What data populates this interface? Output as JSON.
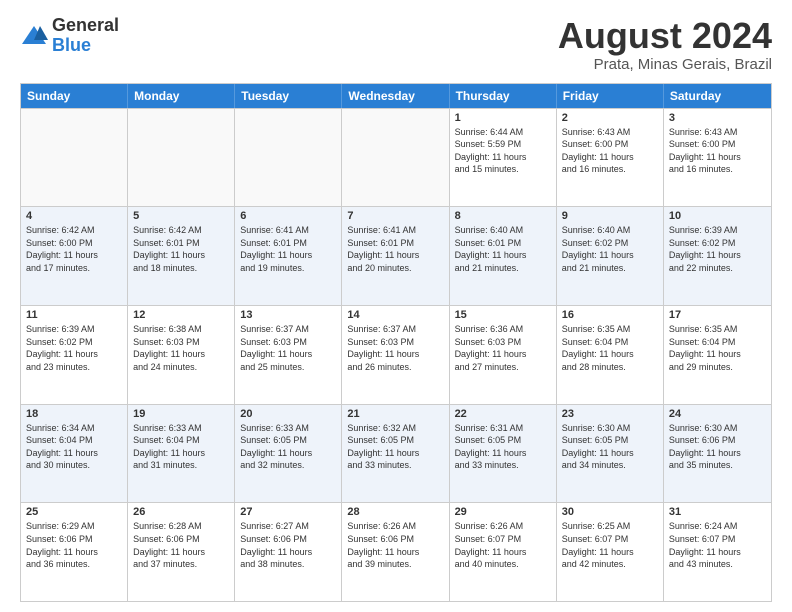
{
  "header": {
    "logo_general": "General",
    "logo_blue": "Blue",
    "month_title": "August 2024",
    "location": "Prata, Minas Gerais, Brazil"
  },
  "calendar": {
    "days_of_week": [
      "Sunday",
      "Monday",
      "Tuesday",
      "Wednesday",
      "Thursday",
      "Friday",
      "Saturday"
    ],
    "rows": [
      [
        {
          "day": "",
          "info": ""
        },
        {
          "day": "",
          "info": ""
        },
        {
          "day": "",
          "info": ""
        },
        {
          "day": "",
          "info": ""
        },
        {
          "day": "1",
          "info": "Sunrise: 6:44 AM\nSunset: 5:59 PM\nDaylight: 11 hours\nand 15 minutes."
        },
        {
          "day": "2",
          "info": "Sunrise: 6:43 AM\nSunset: 6:00 PM\nDaylight: 11 hours\nand 16 minutes."
        },
        {
          "day": "3",
          "info": "Sunrise: 6:43 AM\nSunset: 6:00 PM\nDaylight: 11 hours\nand 16 minutes."
        }
      ],
      [
        {
          "day": "4",
          "info": "Sunrise: 6:42 AM\nSunset: 6:00 PM\nDaylight: 11 hours\nand 17 minutes."
        },
        {
          "day": "5",
          "info": "Sunrise: 6:42 AM\nSunset: 6:01 PM\nDaylight: 11 hours\nand 18 minutes."
        },
        {
          "day": "6",
          "info": "Sunrise: 6:41 AM\nSunset: 6:01 PM\nDaylight: 11 hours\nand 19 minutes."
        },
        {
          "day": "7",
          "info": "Sunrise: 6:41 AM\nSunset: 6:01 PM\nDaylight: 11 hours\nand 20 minutes."
        },
        {
          "day": "8",
          "info": "Sunrise: 6:40 AM\nSunset: 6:01 PM\nDaylight: 11 hours\nand 21 minutes."
        },
        {
          "day": "9",
          "info": "Sunrise: 6:40 AM\nSunset: 6:02 PM\nDaylight: 11 hours\nand 21 minutes."
        },
        {
          "day": "10",
          "info": "Sunrise: 6:39 AM\nSunset: 6:02 PM\nDaylight: 11 hours\nand 22 minutes."
        }
      ],
      [
        {
          "day": "11",
          "info": "Sunrise: 6:39 AM\nSunset: 6:02 PM\nDaylight: 11 hours\nand 23 minutes."
        },
        {
          "day": "12",
          "info": "Sunrise: 6:38 AM\nSunset: 6:03 PM\nDaylight: 11 hours\nand 24 minutes."
        },
        {
          "day": "13",
          "info": "Sunrise: 6:37 AM\nSunset: 6:03 PM\nDaylight: 11 hours\nand 25 minutes."
        },
        {
          "day": "14",
          "info": "Sunrise: 6:37 AM\nSunset: 6:03 PM\nDaylight: 11 hours\nand 26 minutes."
        },
        {
          "day": "15",
          "info": "Sunrise: 6:36 AM\nSunset: 6:03 PM\nDaylight: 11 hours\nand 27 minutes."
        },
        {
          "day": "16",
          "info": "Sunrise: 6:35 AM\nSunset: 6:04 PM\nDaylight: 11 hours\nand 28 minutes."
        },
        {
          "day": "17",
          "info": "Sunrise: 6:35 AM\nSunset: 6:04 PM\nDaylight: 11 hours\nand 29 minutes."
        }
      ],
      [
        {
          "day": "18",
          "info": "Sunrise: 6:34 AM\nSunset: 6:04 PM\nDaylight: 11 hours\nand 30 minutes."
        },
        {
          "day": "19",
          "info": "Sunrise: 6:33 AM\nSunset: 6:04 PM\nDaylight: 11 hours\nand 31 minutes."
        },
        {
          "day": "20",
          "info": "Sunrise: 6:33 AM\nSunset: 6:05 PM\nDaylight: 11 hours\nand 32 minutes."
        },
        {
          "day": "21",
          "info": "Sunrise: 6:32 AM\nSunset: 6:05 PM\nDaylight: 11 hours\nand 33 minutes."
        },
        {
          "day": "22",
          "info": "Sunrise: 6:31 AM\nSunset: 6:05 PM\nDaylight: 11 hours\nand 33 minutes."
        },
        {
          "day": "23",
          "info": "Sunrise: 6:30 AM\nSunset: 6:05 PM\nDaylight: 11 hours\nand 34 minutes."
        },
        {
          "day": "24",
          "info": "Sunrise: 6:30 AM\nSunset: 6:06 PM\nDaylight: 11 hours\nand 35 minutes."
        }
      ],
      [
        {
          "day": "25",
          "info": "Sunrise: 6:29 AM\nSunset: 6:06 PM\nDaylight: 11 hours\nand 36 minutes."
        },
        {
          "day": "26",
          "info": "Sunrise: 6:28 AM\nSunset: 6:06 PM\nDaylight: 11 hours\nand 37 minutes."
        },
        {
          "day": "27",
          "info": "Sunrise: 6:27 AM\nSunset: 6:06 PM\nDaylight: 11 hours\nand 38 minutes."
        },
        {
          "day": "28",
          "info": "Sunrise: 6:26 AM\nSunset: 6:06 PM\nDaylight: 11 hours\nand 39 minutes."
        },
        {
          "day": "29",
          "info": "Sunrise: 6:26 AM\nSunset: 6:07 PM\nDaylight: 11 hours\nand 40 minutes."
        },
        {
          "day": "30",
          "info": "Sunrise: 6:25 AM\nSunset: 6:07 PM\nDaylight: 11 hours\nand 42 minutes."
        },
        {
          "day": "31",
          "info": "Sunrise: 6:24 AM\nSunset: 6:07 PM\nDaylight: 11 hours\nand 43 minutes."
        }
      ]
    ]
  }
}
